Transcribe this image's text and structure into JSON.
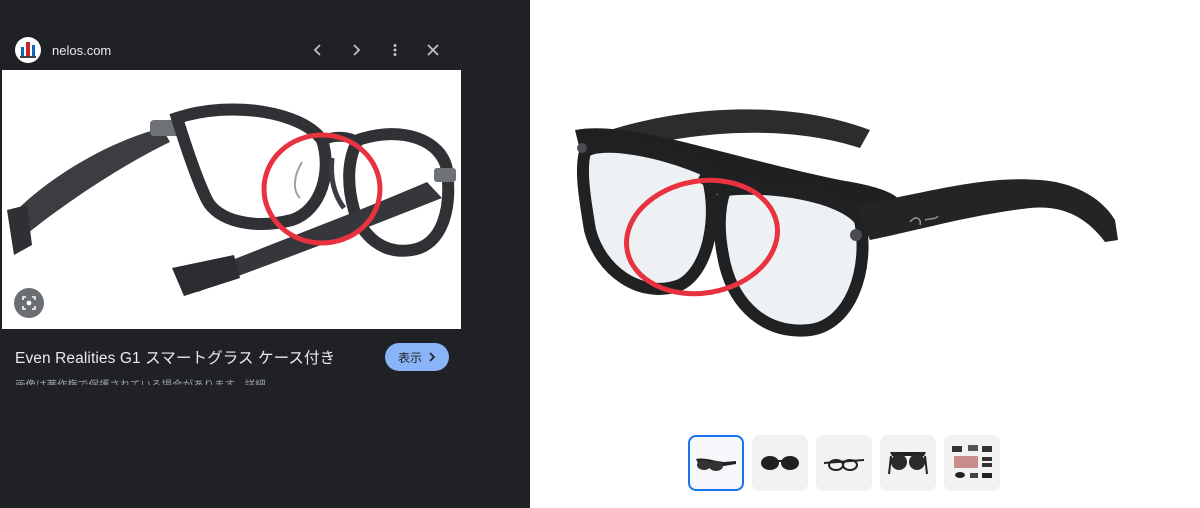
{
  "viewer": {
    "site_name": "nelos.com",
    "title": "Even Realities G1 スマートグラス ケース付き",
    "view_button_label": "表示",
    "notice": "画像は著作権で保護されている場合があります。詳細"
  },
  "icons": {
    "prev": "chevron-left-icon",
    "next": "chevron-right-icon",
    "more": "more-vert-icon",
    "close": "close-icon",
    "lens": "lens-search-icon"
  },
  "colors": {
    "panel_bg": "#202124",
    "accent_button": "#8ab4f8",
    "highlight_circle": "#e8323f",
    "thumb_selected_border": "#1a73e8"
  },
  "product_gallery": {
    "thumbnail_count": 5,
    "selected_thumbnail_index": 0
  }
}
